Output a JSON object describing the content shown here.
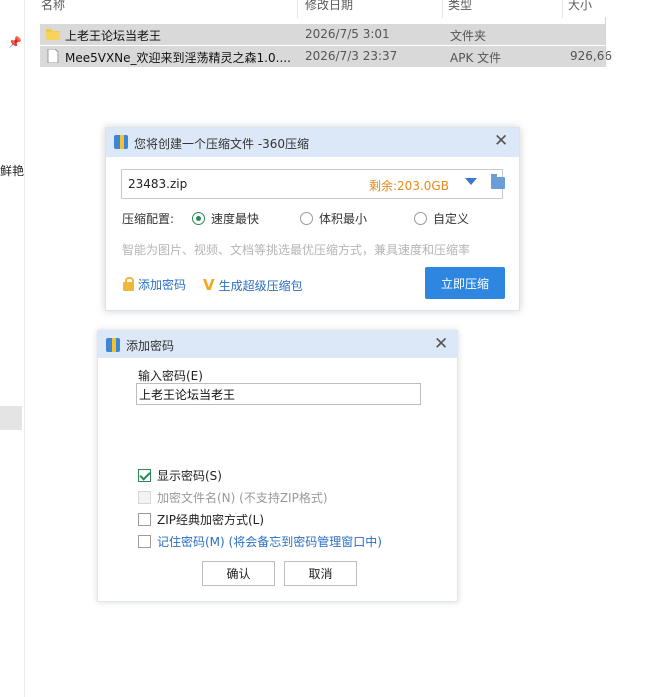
{
  "explorer": {
    "columns": {
      "name": "名称",
      "date": "修改日期",
      "type": "类型",
      "size": "大小"
    },
    "left_cut_text": "鲜艳",
    "files": [
      {
        "name": "上老王论坛当老王",
        "date": "2026/7/5 3:01",
        "type": "文件夹",
        "size": "",
        "icon": "folder-icon"
      },
      {
        "name": "Mee5VXNe_欢迎来到淫荡精灵之森1.0....",
        "date": "2026/7/3 23:37",
        "type": "APK 文件",
        "size": "926,66",
        "icon": "file-icon"
      }
    ]
  },
  "compress_dialog": {
    "title": "您将创建一个压缩文件 -360压缩",
    "filename": "23483.zip",
    "free_space": "剩余:203.0GB",
    "config_label": "压缩配置:",
    "options": [
      {
        "label": "速度最快",
        "selected": true
      },
      {
        "label": "体积最小",
        "selected": false
      },
      {
        "label": "自定义",
        "selected": false
      }
    ],
    "hint": "智能为图片、视频、文档等挑选最优压缩方式，兼具速度和压缩率",
    "add_password": "添加密码",
    "super_pack": "生成超级压缩包",
    "compress_now": "立即压缩"
  },
  "password_dialog": {
    "title": "添加密码",
    "input_label": "输入密码(E)",
    "password_value": "上老王论坛当老王",
    "show_password": "显示密码(S)",
    "encrypt_names": "加密文件名(N) (不支持ZIP格式)",
    "zip_classic": "ZIP经典加密方式(L)",
    "remember": "记住密码(M) (将会备忘到密码管理窗口中)",
    "confirm": "确认",
    "cancel": "取消"
  },
  "colors": {
    "accent": "#2d87e0",
    "title_bar": "#dce8f7",
    "free_space": "#e48a16",
    "check_green": "#2a8a55"
  }
}
